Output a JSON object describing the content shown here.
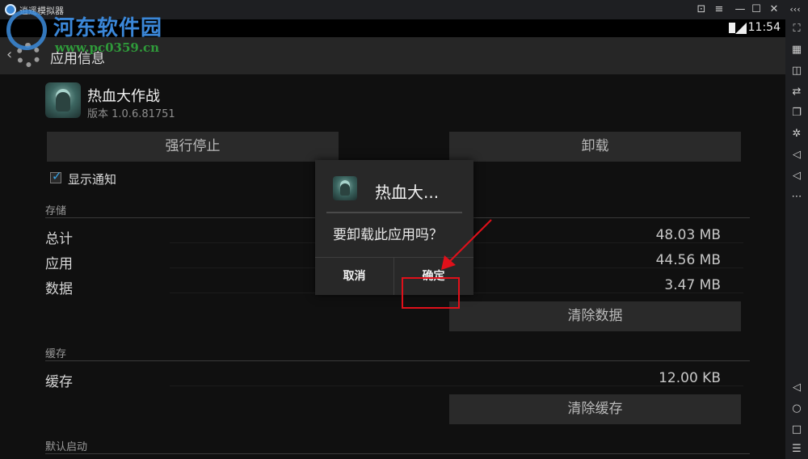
{
  "emulator": {
    "title": "逍遥模拟器",
    "window_buttons": [
      "⊡",
      "≡",
      "—",
      "☐",
      "✕",
      "‹‹‹"
    ]
  },
  "watermark": {
    "title": "河东软件园",
    "url": "www.pc0359.cn"
  },
  "statusbar": {
    "time": "11:54"
  },
  "actionbar": {
    "title": "应用信息"
  },
  "app": {
    "name": "热血大作战",
    "version": "版本 1.0.6.81751"
  },
  "buttons": {
    "force_stop": "强行停止",
    "uninstall": "卸载",
    "clear_data": "清除数据",
    "clear_cache": "清除缓存"
  },
  "notifications": {
    "label": "显示通知",
    "checked": true
  },
  "storage": {
    "header": "存储",
    "rows": [
      {
        "label": "总计",
        "value": "48.03 MB"
      },
      {
        "label": "应用",
        "value": "44.56 MB"
      },
      {
        "label": "数据",
        "value": "3.47 MB"
      }
    ]
  },
  "cache": {
    "header": "缓存",
    "rows": [
      {
        "label": "缓存",
        "value": "12.00 KB"
      }
    ]
  },
  "defaults": {
    "header": "默认启动"
  },
  "dialog": {
    "title": "热血大...",
    "message": "要卸载此应用吗？",
    "cancel": "取消",
    "confirm": "确定"
  },
  "sidebar_icons": [
    "fullscreen-icon",
    "keyboard-icon",
    "screenshot-icon",
    "transfer-icon",
    "window-icon",
    "settings-icon",
    "volume-up-icon",
    "volume-down-icon",
    "more-icon",
    "back-nav-icon",
    "home-nav-icon",
    "recent-nav-icon",
    "menu-icon"
  ],
  "colors": {
    "accent": "#38a4e6",
    "highlight": "#e0101a"
  }
}
